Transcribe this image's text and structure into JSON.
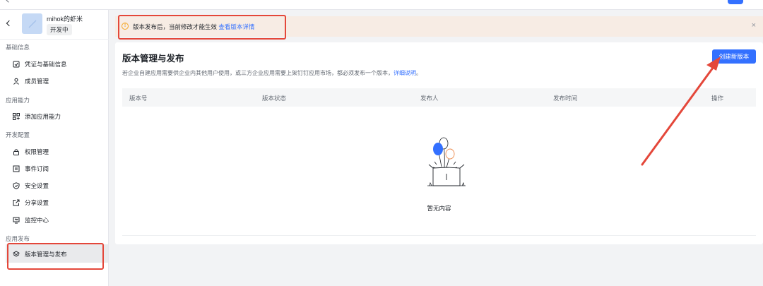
{
  "app": {
    "name": "mihok的虾米",
    "status": "开发中"
  },
  "sidebar": {
    "groups": [
      {
        "title": "基础信息",
        "items": [
          {
            "label": "凭证与基础信息",
            "icon": "credential-icon"
          },
          {
            "label": "成员管理",
            "icon": "person-icon"
          }
        ]
      },
      {
        "title": "应用能力",
        "items": [
          {
            "label": "添加应用能力",
            "icon": "grid-add-icon"
          }
        ]
      },
      {
        "title": "开发配置",
        "items": [
          {
            "label": "权限管理",
            "icon": "lock-icon"
          },
          {
            "label": "事件订阅",
            "icon": "event-icon"
          },
          {
            "label": "安全设置",
            "icon": "shield-icon"
          },
          {
            "label": "分享设置",
            "icon": "share-icon"
          },
          {
            "label": "监控中心",
            "icon": "monitor-icon"
          }
        ]
      },
      {
        "title": "应用发布",
        "items": [
          {
            "label": "版本管理与发布",
            "icon": "layers-icon",
            "active": true
          }
        ]
      }
    ]
  },
  "banner": {
    "text": "版本发布后，当前修改才能生效",
    "link": "查看版本详情",
    "close": "×"
  },
  "main": {
    "title": "版本管理与发布",
    "description": "若企业自建应用需要供企业内其他用户使用，或三方企业应用需要上架钉钉应用市场，都必须发布一个版本，",
    "description_link": "详细说明",
    "description_end": "。",
    "create_button": "创建新版本",
    "columns": [
      "版本号",
      "版本状态",
      "发布人",
      "发布时间",
      "操作"
    ],
    "empty_text": "暂无内容"
  },
  "colors": {
    "accent": "#3370ff",
    "annotation": "#e4473a",
    "banner_bg": "#f7ece4"
  }
}
